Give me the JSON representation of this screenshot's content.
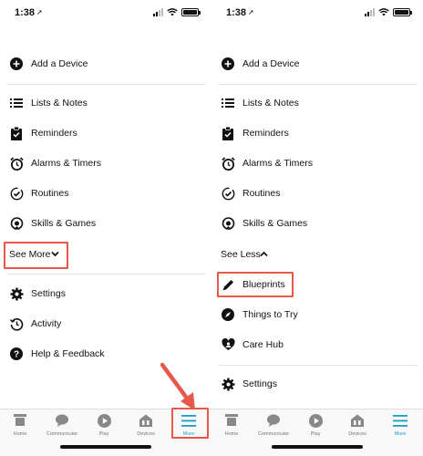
{
  "status_bar": {
    "time": "1:38",
    "location_glyph": "➚"
  },
  "left_panel": {
    "menu": [
      {
        "id": "add-device",
        "label": "Add a Device",
        "icon": "plus-circle-icon"
      },
      {
        "id": "lists-notes",
        "label": "Lists & Notes",
        "icon": "list-icon"
      },
      {
        "id": "reminders",
        "label": "Reminders",
        "icon": "clipboard-check-icon"
      },
      {
        "id": "alarms-timers",
        "label": "Alarms & Timers",
        "icon": "alarm-clock-icon"
      },
      {
        "id": "routines",
        "label": "Routines",
        "icon": "routine-check-icon"
      },
      {
        "id": "skills-games",
        "label": "Skills & Games",
        "icon": "skills-icon"
      }
    ],
    "toggle_label": "See More",
    "bottom_menu": [
      {
        "id": "settings",
        "label": "Settings",
        "icon": "gear-icon"
      },
      {
        "id": "activity",
        "label": "Activity",
        "icon": "history-icon"
      },
      {
        "id": "help-feedback",
        "label": "Help & Feedback",
        "icon": "help-icon"
      }
    ]
  },
  "right_panel": {
    "menu": [
      {
        "id": "add-device",
        "label": "Add a Device",
        "icon": "plus-circle-icon"
      },
      {
        "id": "lists-notes",
        "label": "Lists & Notes",
        "icon": "list-icon"
      },
      {
        "id": "reminders",
        "label": "Reminders",
        "icon": "clipboard-check-icon"
      },
      {
        "id": "alarms-timers",
        "label": "Alarms & Timers",
        "icon": "alarm-clock-icon"
      },
      {
        "id": "routines",
        "label": "Routines",
        "icon": "routine-check-icon"
      },
      {
        "id": "skills-games",
        "label": "Skills & Games",
        "icon": "skills-icon"
      }
    ],
    "toggle_label": "See Less",
    "extra_menu": [
      {
        "id": "blueprints",
        "label": "Blueprints",
        "icon": "pencil-icon"
      },
      {
        "id": "things-to-try",
        "label": "Things to Try",
        "icon": "compass-icon"
      },
      {
        "id": "care-hub",
        "label": "Care Hub",
        "icon": "care-heart-icon"
      }
    ],
    "bottom_menu": [
      {
        "id": "settings",
        "label": "Settings",
        "icon": "gear-icon"
      }
    ]
  },
  "tab_bar": {
    "tabs": [
      {
        "id": "home",
        "label": "Home",
        "icon": "home-icon"
      },
      {
        "id": "communicate",
        "label": "Communicate",
        "icon": "speech-bubble-icon"
      },
      {
        "id": "play",
        "label": "Play",
        "icon": "play-icon"
      },
      {
        "id": "devices",
        "label": "Devices",
        "icon": "devices-icon"
      },
      {
        "id": "more",
        "label": "More",
        "icon": "hamburger-icon"
      }
    ],
    "active": "more"
  },
  "colors": {
    "accent": "#1c9cc4",
    "highlight": "#e8584a",
    "text": "#111111",
    "tab_inactive": "#777777"
  }
}
